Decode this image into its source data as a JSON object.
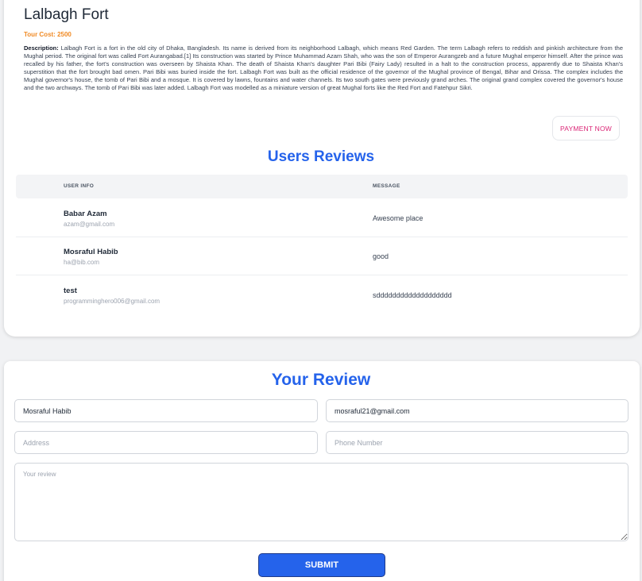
{
  "tour": {
    "title": "Lalbagh Fort",
    "cost": "Tour Cost: 2500",
    "description_label": "Description:",
    "description_text": " Lalbagh Fort is a fort in the old city of Dhaka, Bangladesh. Its name is derived from its neighborhood Lalbagh, which means Red Garden. The term Lalbagh refers to reddish and pinkish architecture from the Mughal period. The original fort was called Fort Aurangabad.[1] Its construction was started by Prince Muhammad Azam Shah, who was the son of Emperor Aurangzeb and a future Mughal emperor himself. After the prince was recalled by his father, the fort's construction was overseen by Shaista Khan. The death of Shaista Khan's daughter Pari Bibi (Fairy Lady) resulted in a halt to the construction process, apparently due to Shaista Khan's superstition that the fort brought bad omen. Pari Bibi was buried inside the fort. Lalbagh Fort was built as the official residence of the governor of the Mughal province of Bengal, Bihar and Orissa. The complex includes the Mughal governor's house, the tomb of Pari Bibi and a mosque. It is covered by lawns, fountains and water channels. Its two south gates were previously grand arches. The original grand complex covered the governor's house and the two archways. The tomb of Pari Bibi was later added. Lalbagh Fort was modelled as a miniature version of great Mughal forts like the Red Fort and Fatehpur Sikri.",
    "payment_label": "PAYMENT NOW"
  },
  "reviews": {
    "heading": "Users Reviews",
    "col_user": "USER INFO",
    "col_message": "MESSAGE",
    "rows": [
      {
        "name": "Babar Azam",
        "email": "azam@gmail.com",
        "message": "Awesome place"
      },
      {
        "name": "Mosraful Habib",
        "email": "ha@bib.com",
        "message": "good"
      },
      {
        "name": "test",
        "email": "programminghero006@gmail.com",
        "message": "sddddddddddddddddddd"
      }
    ]
  },
  "form": {
    "heading": "Your Review",
    "name_value": "Mosraful Habib",
    "email_value": "mosraful21@gmail.com",
    "address_placeholder": "Address",
    "phone_placeholder": "Phone Number",
    "review_placeholder": "Your review",
    "submit_label": "SUBMIT"
  },
  "colors": {
    "accent": "#2563eb",
    "cost": "#f08a24",
    "payment": "#db2777"
  }
}
